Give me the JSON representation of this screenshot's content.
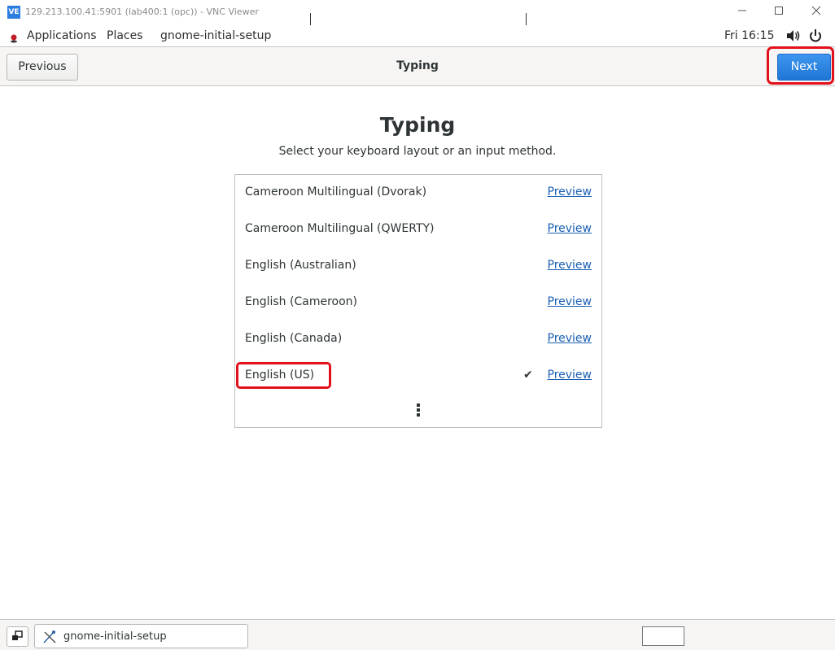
{
  "vnc": {
    "icon_text": "VE",
    "title": "129.213.100.41:5901 (lab400:1 (opc)) - VNC Viewer",
    "minimize_icon": "minimize-icon",
    "maximize_icon": "maximize-icon",
    "close_icon": "close-icon"
  },
  "panel": {
    "applications": "Applications",
    "places": "Places",
    "app_name": "gnome-initial-setup",
    "clock": "Fri 16:15",
    "volume_icon": "volume-icon",
    "power_icon": "power-icon"
  },
  "header": {
    "previous": "Previous",
    "title": "Typing",
    "next": "Next"
  },
  "page": {
    "heading": "Typing",
    "subtitle": "Select your keyboard layout or an input method.",
    "layouts": [
      {
        "name": "Cameroon Multilingual (Dvorak)",
        "preview": "Preview",
        "selected": false
      },
      {
        "name": "Cameroon Multilingual (QWERTY)",
        "preview": "Preview",
        "selected": false
      },
      {
        "name": "English (Australian)",
        "preview": "Preview",
        "selected": false
      },
      {
        "name": "English (Cameroon)",
        "preview": "Preview",
        "selected": false
      },
      {
        "name": "English (Canada)",
        "preview": "Preview",
        "selected": false
      },
      {
        "name": "English (US)",
        "preview": "Preview",
        "selected": true
      }
    ],
    "check_glyph": "✔",
    "more_icon": "more-vertical-icon"
  },
  "taskbar": {
    "task_label": "gnome-initial-setup"
  },
  "colors": {
    "accent": "#1f75d5",
    "highlight": "#e2101b",
    "link": "#1a5fb4"
  }
}
